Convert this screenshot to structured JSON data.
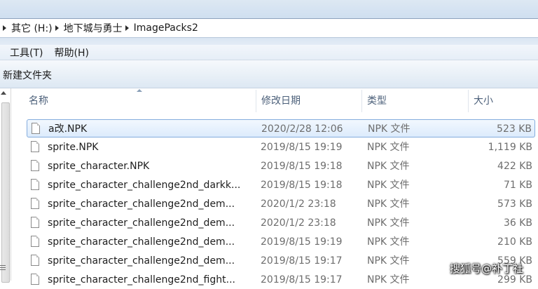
{
  "breadcrumb": {
    "items": [
      "其它 (H:)",
      "地下城与勇士",
      "ImagePacks2"
    ]
  },
  "menu": {
    "items": [
      "工具(T)",
      "帮助(H)"
    ]
  },
  "toolbar": {
    "new_folder_label": "新建文件夹"
  },
  "columns": {
    "name": "名称",
    "date": "修改日期",
    "type": "类型",
    "size": "大小"
  },
  "files": [
    {
      "name": "a改.NPK",
      "date": "2020/2/28 12:06",
      "type": "NPK 文件",
      "size": "523 KB",
      "selected": true
    },
    {
      "name": "sprite.NPK",
      "date": "2019/8/15 19:19",
      "type": "NPK 文件",
      "size": "1,119 KB"
    },
    {
      "name": "sprite_character.NPK",
      "date": "2019/8/15 19:18",
      "type": "NPK 文件",
      "size": "422 KB"
    },
    {
      "name": "sprite_character_challenge2nd_darkk...",
      "date": "2019/8/15 19:18",
      "type": "NPK 文件",
      "size": "71 KB"
    },
    {
      "name": "sprite_character_challenge2nd_dem...",
      "date": "2020/1/2 23:18",
      "type": "NPK 文件",
      "size": "573 KB"
    },
    {
      "name": "sprite_character_challenge2nd_dem...",
      "date": "2020/1/2 23:18",
      "type": "NPK 文件",
      "size": "36 KB"
    },
    {
      "name": "sprite_character_challenge2nd_dem...",
      "date": "2019/8/15 19:19",
      "type": "NPK 文件",
      "size": "210 KB"
    },
    {
      "name": "sprite_character_challenge2nd_dem...",
      "date": "2019/8/15 19:17",
      "type": "NPK 文件",
      "size": "559 KB"
    },
    {
      "name": "sprite_character_challenge2nd_fight...",
      "date": "2019/8/15 19:17",
      "type": "NPK 文件",
      "size": "299 KB"
    }
  ],
  "watermark": "搜狐号@补丁社"
}
